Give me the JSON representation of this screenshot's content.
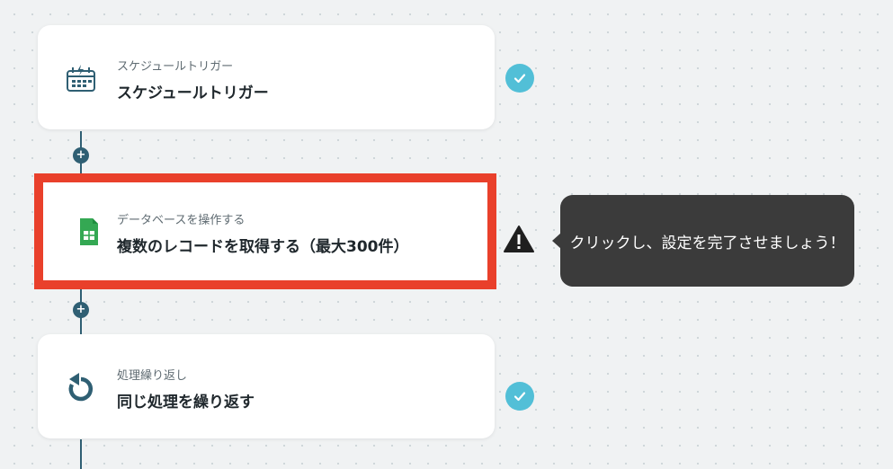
{
  "flow": {
    "steps": [
      {
        "subtitle": "スケジュールトリガー",
        "title": "スケジュールトリガー",
        "icon": "calendar-lightning-icon",
        "status": "complete"
      },
      {
        "subtitle": "データベースを操作する",
        "title": "複数のレコードを取得する（最大300件）",
        "icon": "google-sheets-icon",
        "status": "warning"
      },
      {
        "subtitle": "処理繰り返し",
        "title": "同じ処理を繰り返す",
        "icon": "loop-icon",
        "status": "complete"
      }
    ],
    "add_symbol": "+"
  },
  "tooltip": {
    "text": "クリックし、設定を完了させましょう！"
  },
  "colors": {
    "connector": "#2f5f73",
    "highlight": "#e9402b",
    "check": "#52bfd7",
    "tooltip": "#3b3b3b",
    "sheets": "#34a853"
  }
}
